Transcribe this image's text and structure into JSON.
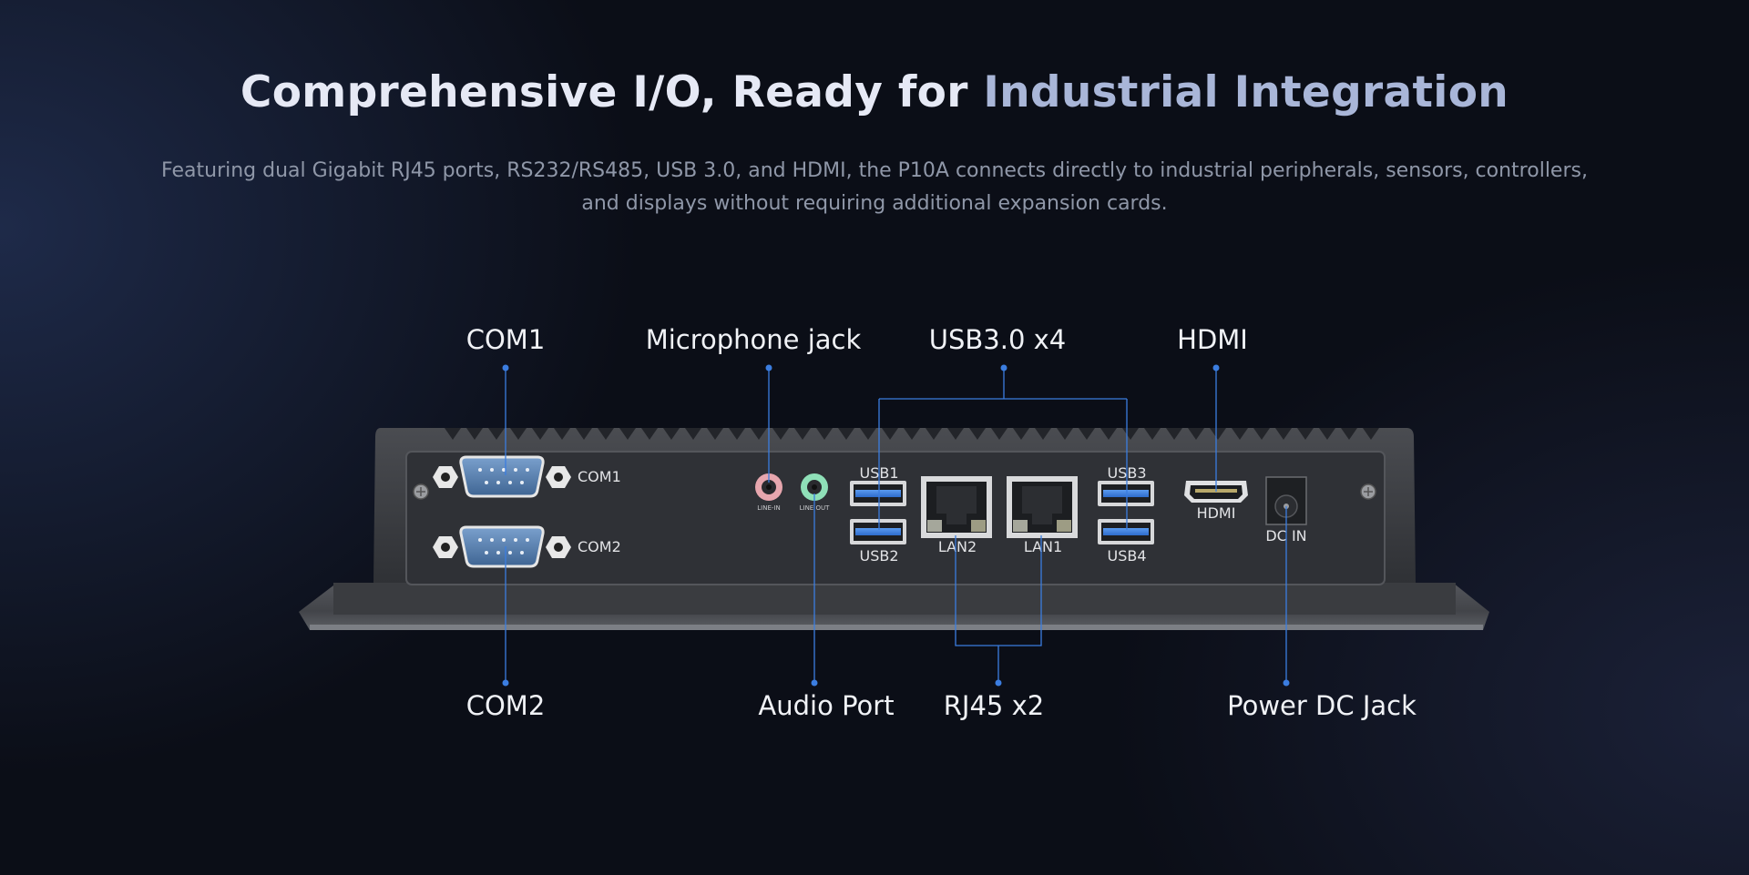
{
  "header": {
    "title_main": "Comprehensive I/O, Ready for ",
    "title_accent": "Industrial Integration",
    "subtitle": "Featuring dual Gigabit RJ45 ports, RS232/RS485, USB 3.0, and HDMI, the P10A connects directly to industrial peripherals, sensors, controllers, and displays without requiring additional expansion cards."
  },
  "callouts": {
    "top": {
      "com1": "COM1",
      "microphone": "Microphone jack",
      "usb": "USB3.0 x4",
      "hdmi": "HDMI"
    },
    "bottom": {
      "com2": "COM2",
      "audio": "Audio Port",
      "rj45": "RJ45 x2",
      "power": "Power DC Jack"
    }
  },
  "panel_labels": {
    "com1": "COM1",
    "com2": "COM2",
    "line_in": "LINE-IN",
    "line_out": "LINE OUT",
    "usb1": "USB1",
    "usb2": "USB2",
    "usb3": "USB3",
    "usb4": "USB4",
    "lan2": "LAN2",
    "lan1": "LAN1",
    "hdmi": "HDMI",
    "dc_in": "DC IN"
  },
  "colors": {
    "callout_line": "#3b7de0",
    "serial_port_blue": "#5f86b6",
    "usb_blue": "#3e7fd8",
    "line_in_pink": "#e7a6ae",
    "line_out_green": "#8fe0b8",
    "chassis": "#3d3f44"
  }
}
